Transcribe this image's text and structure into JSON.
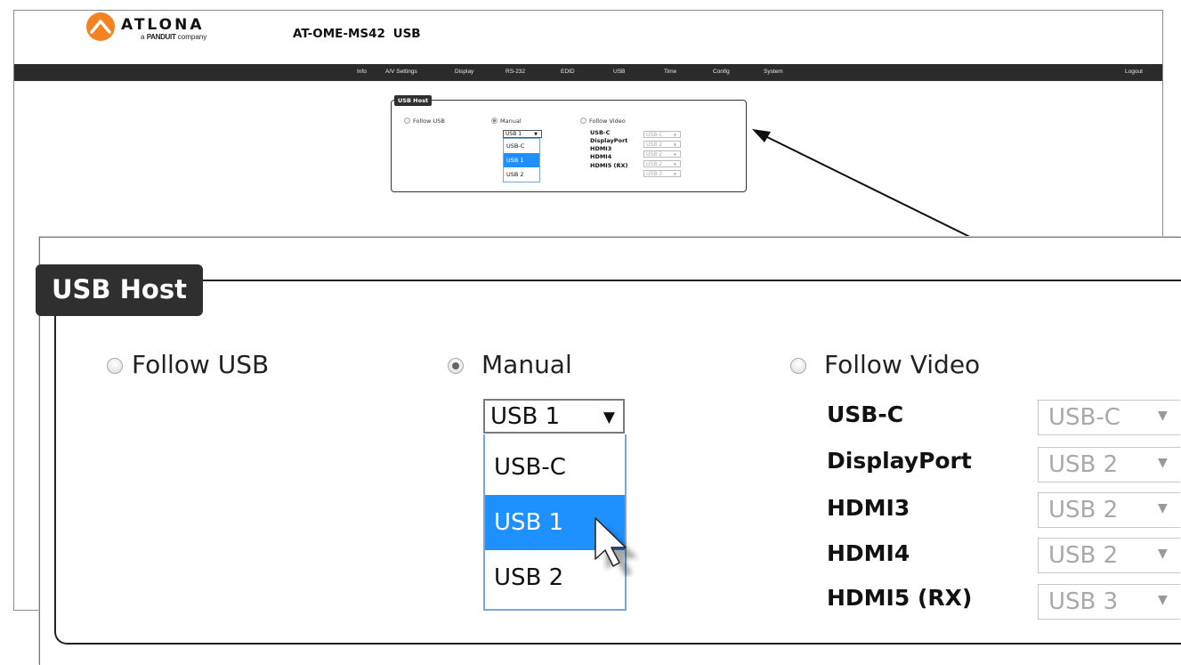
{
  "header": {
    "logo_word": "ATLONA",
    "logo_sub_prefix": "a",
    "logo_sub_brand": "PANDUIT",
    "logo_sub_suffix": "company",
    "title": "AT-OME-MS42 USB"
  },
  "nav": {
    "items": [
      "Info",
      "A/V Settings",
      "Display",
      "RS-232",
      "EDID",
      "USB",
      "Time",
      "Config",
      "System"
    ],
    "logout": "Logout"
  },
  "usb_host": {
    "legend": "USB Host",
    "options": {
      "follow_usb": "Follow USB",
      "manual": "Manual",
      "follow_video": "Follow Video"
    },
    "selected_option": "Manual",
    "manual_select": {
      "value": "USB 1",
      "options": [
        "USB-C",
        "USB 1",
        "USB 2"
      ],
      "highlighted": "USB 1"
    },
    "video_sources": [
      {
        "label": "USB-C",
        "value": "USB-C"
      },
      {
        "label": "DisplayPort",
        "value": "USB 2"
      },
      {
        "label": "HDMI3",
        "value": "USB 2"
      },
      {
        "label": "HDMI4",
        "value": "USB 2"
      },
      {
        "label": "HDMI5 (RX)",
        "value": "USB 3"
      }
    ]
  },
  "icons": {
    "logo": "atlona-logo-icon",
    "dropdown": "dropdown-arrow-icon",
    "cursor": "mouse-pointer-icon",
    "callout": "callout-arrow-icon"
  },
  "colors": {
    "navbar": "#2b2b2b",
    "legend_bg": "#2f2f2f",
    "highlight": "#1e90ff",
    "logo_orange": "#f58220",
    "disabled_text": "#a9a9a9"
  }
}
